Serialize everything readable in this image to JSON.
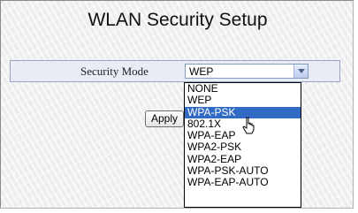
{
  "page": {
    "title": "WLAN Security Setup"
  },
  "security_mode": {
    "label": "Security Mode",
    "selected_value": "WEP",
    "options": [
      "NONE",
      "WEP",
      "WPA-PSK",
      "802.1X",
      "WPA-EAP",
      "WPA2-PSK",
      "WPA2-EAP",
      "WPA-PSK-AUTO",
      "WPA-EAP-AUTO"
    ],
    "highlighted_option": "WPA-PSK",
    "dropdown_open": true
  },
  "actions": {
    "apply_label": "Apply"
  },
  "icons": {
    "dropdown": "chevron-down-icon",
    "cursor": "mouse-pointer-icon"
  },
  "colors": {
    "highlight": "#316ac5",
    "row_background": "#e9ecf5",
    "row_border": "#9aa4c6"
  }
}
